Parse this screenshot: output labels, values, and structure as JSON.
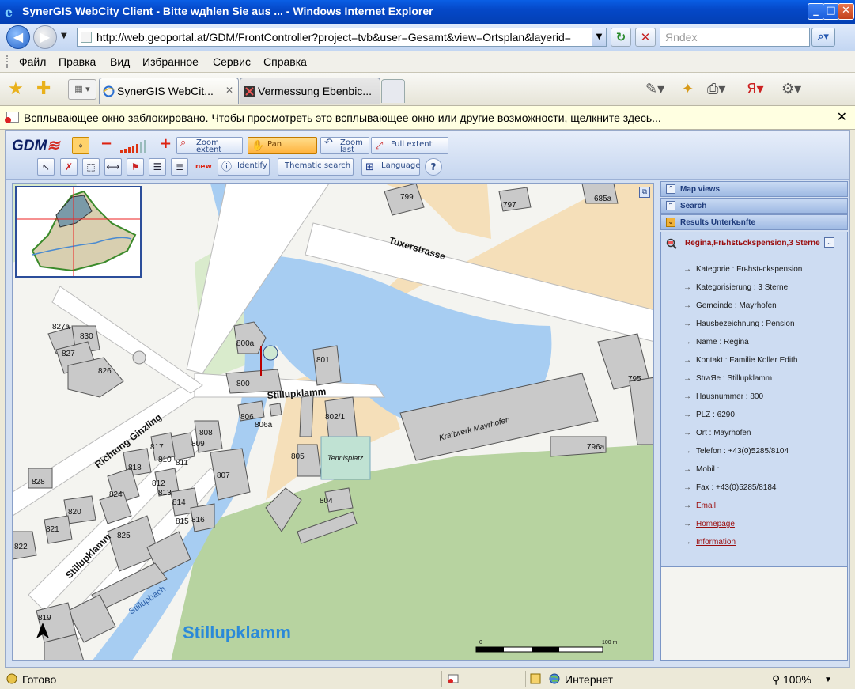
{
  "window": {
    "title": "SynerGIS WebCity Client - Bitte wдhlen Sie aus ... - Windows Internet Explorer",
    "controls": {
      "minimize": "_",
      "maximize": "□",
      "close": "✕"
    }
  },
  "address": {
    "url": "http://web.geoportal.at/GDM/FrontController?project=tvb&user=Gesamt&view=Ortsplan&layerid=",
    "search_placeholder": "Яndex"
  },
  "menu": [
    "Файл",
    "Правка",
    "Вид",
    "Избранное",
    "Сервис",
    "Справка"
  ],
  "tabs": [
    {
      "label": "SynerGIS WebCit...",
      "active": true,
      "close": "✕"
    },
    {
      "label": "Vermessung Ebenbic...",
      "active": false
    }
  ],
  "infobar": {
    "text": "Всплывающее окно заблокировано. Чтобы просмотреть это всплывающее окно или другие возможности, щелкните здесь...",
    "close": "✕"
  },
  "app": {
    "logo": "GDM",
    "toolbar": {
      "zoom_in": "+",
      "zoom_out": "−",
      "zoom_extent": [
        "Zoom",
        "extent"
      ],
      "pan": "Pan",
      "zoom_last": [
        "Zoom",
        "last"
      ],
      "full_extent": "Full extent",
      "new_badge": "new",
      "identify": "Identify",
      "thematic_search": "Thematic search",
      "language": "Language",
      "help": "?"
    },
    "panel": {
      "map_views": "Map views",
      "search": "Search",
      "results": "Results Unterkьnfte"
    },
    "result": {
      "title": "Regina,Frьhstьckspension,3 Sterne",
      "attributes": [
        {
          "text": "Kategorie : Frьhstьckspension",
          "link": false
        },
        {
          "text": "Kategorisierung : 3 Sterne",
          "link": false
        },
        {
          "text": "Gemeinde : Mayrhofen",
          "link": false
        },
        {
          "text": "Hausbezeichnung : Pension",
          "link": false
        },
        {
          "text": "Name : Regina",
          "link": false
        },
        {
          "text": "Kontakt : Familie Koller Edith",
          "link": false
        },
        {
          "text": "StraЯe : Stillupklamm",
          "link": false
        },
        {
          "text": "Hausnummer : 800",
          "link": false
        },
        {
          "text": "PLZ : 6290",
          "link": false
        },
        {
          "text": "Ort : Mayrhofen",
          "link": false
        },
        {
          "text": "Telefon : +43(0)5285/8104",
          "link": false
        },
        {
          "text": "Mobil :",
          "link": false
        },
        {
          "text": "Fax : +43(0)5285/8184",
          "link": false
        },
        {
          "text": "Email",
          "link": true
        },
        {
          "text": "Homepage",
          "link": true
        },
        {
          "text": "Information",
          "link": true
        }
      ]
    },
    "map": {
      "streets": [
        "Tuxerstrasse",
        "Stillupklamm",
        "Richtung Ginzling",
        "Stillupklamm",
        "Stillupbach"
      ],
      "area_label": "Stillupklamm",
      "plant_label": "Kraftwerk Mayrhofen",
      "court_label": "Tennisplatz",
      "house_numbers": [
        "799",
        "797",
        "685a",
        "827a",
        "830",
        "827",
        "826",
        "800a",
        "801",
        "800",
        "795",
        "806",
        "806a",
        "802/1",
        "808",
        "809",
        "817",
        "811",
        "810",
        "818",
        "807",
        "805",
        "796a",
        "828",
        "824",
        "812",
        "813",
        "814",
        "815",
        "816",
        "804",
        "820",
        "821",
        "825",
        "822",
        "819"
      ],
      "scale": {
        "start": "0",
        "end": "100 m"
      }
    }
  },
  "statusbar": {
    "status": "Готово",
    "zone": "Интернет",
    "zoom": "100%"
  }
}
